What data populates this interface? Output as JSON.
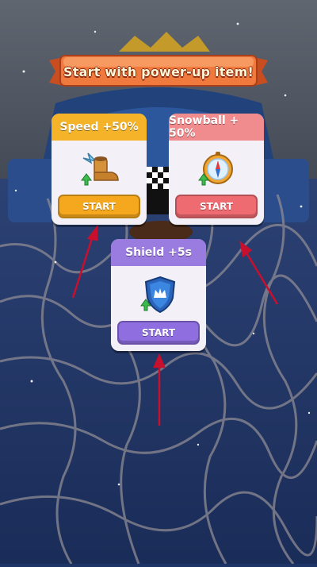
{
  "banner": {
    "title": "Start with power-up item!"
  },
  "cards": {
    "speed": {
      "title": "Speed +50%",
      "button": "START",
      "icon": "winged-boot-icon"
    },
    "snowball": {
      "title": "Snowball + 50%",
      "button": "START",
      "icon": "compass-icon"
    },
    "shield": {
      "title": "Shield +5s",
      "button": "START",
      "icon": "crown-shield-icon"
    }
  },
  "colors": {
    "banner": "#f07a3e",
    "speed_header": "#f5b32a",
    "snowball_header": "#f08b8e",
    "shield_header": "#9a7be0",
    "arrow": "#c8102e",
    "ground": "#1d3566"
  }
}
